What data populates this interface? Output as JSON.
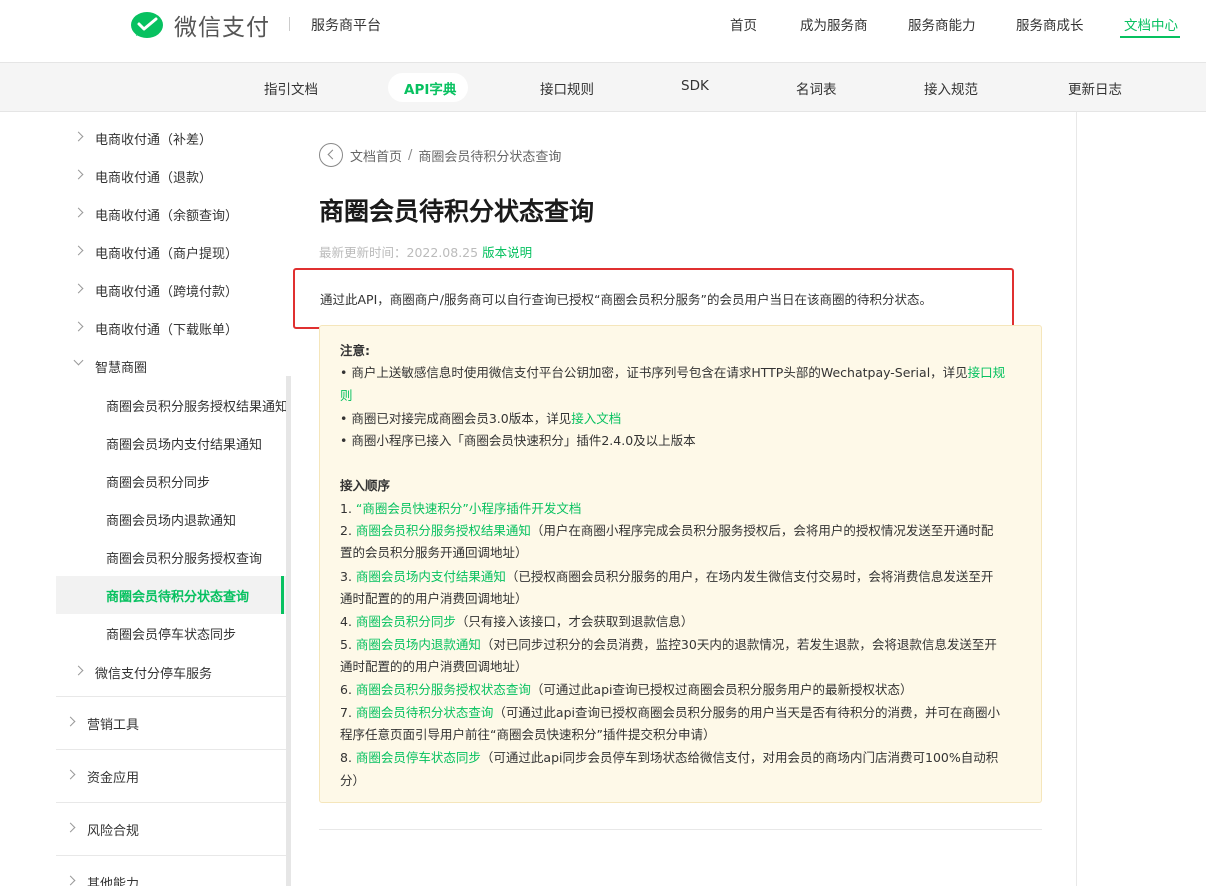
{
  "header": {
    "logo_text": "微信支付",
    "platform": "服务商平台",
    "nav": [
      "首页",
      "成为服务商",
      "服务商能力",
      "服务商成长",
      "文档中心"
    ],
    "nav_active": "文档中心"
  },
  "subnav": {
    "items": [
      "指引文档",
      "API字典",
      "接口规则",
      "SDK",
      "名词表",
      "接入规范",
      "更新日志"
    ],
    "active": "API字典"
  },
  "sidebar": {
    "items": [
      {
        "label": "电商收付通（补差）",
        "level": 1
      },
      {
        "label": "电商收付通（退款）",
        "level": 1
      },
      {
        "label": "电商收付通（余额查询）",
        "level": 1
      },
      {
        "label": "电商收付通（商户提现）",
        "level": 1
      },
      {
        "label": "电商收付通（跨境付款）",
        "level": 1
      },
      {
        "label": "电商收付通（下载账单）",
        "level": 1
      },
      {
        "label": "智慧商圈",
        "level": 1,
        "expanded": true
      },
      {
        "label": "商圈会员积分服务授权结果通知",
        "level": 2
      },
      {
        "label": "商圈会员场内支付结果通知",
        "level": 2
      },
      {
        "label": "商圈会员积分同步",
        "level": 2
      },
      {
        "label": "商圈会员场内退款通知",
        "level": 2
      },
      {
        "label": "商圈会员积分服务授权查询",
        "level": 2
      },
      {
        "label": "商圈会员待积分状态查询",
        "level": 2,
        "selected": true
      },
      {
        "label": "商圈会员停车状态同步",
        "level": 2
      },
      {
        "label": "微信支付分停车服务",
        "level": 1
      }
    ],
    "groups": [
      "营销工具",
      "资金应用",
      "风险合规",
      "其他能力"
    ]
  },
  "breadcrumb": {
    "home": "文档首页",
    "sep": "/",
    "current": "商圈会员待积分状态查询"
  },
  "page_title": "商圈会员待积分状态查询",
  "meta": {
    "updated_label": "最新更新时间：",
    "updated_date": "2022.08.25",
    "version_link": "版本说明"
  },
  "intro": "通过此API，商圈商户/服务商可以自行查询已授权“商圈会员积分服务”的会员用户当日在该商圈的待积分状态。",
  "notice": {
    "heading": "注意:",
    "line1_a": "• 商户上送敏感信息时使用微信支付平台公钥加密，证书序列号包含在请求HTTP头部的Wechatpay-Serial，详见",
    "line1_link_a": "接口规",
    "line1_link_b": "则",
    "line2_a": "• 商圈已对接完成商圈会员3.0版本，详见",
    "line2_link": "接入文档",
    "line3": "• 商圈小程序已接入「商圈会员快速积分」插件2.4.0及以上版本"
  },
  "order": {
    "heading": "接入顺序",
    "steps": [
      {
        "num": "1. ",
        "link": "“商圈会员快速积分”小程序插件开发文档",
        "desc": "",
        "desc2": ""
      },
      {
        "num": "2. ",
        "link": "商圈会员积分服务授权结果通知",
        "desc": "（用户在商圈小程序完成会员积分服务授权后，会将用户的授权情况发送至开通时配",
        "desc2": "置的会员积分服务开通回调地址）"
      },
      {
        "num": "3. ",
        "link": "商圈会员场内支付结果通知",
        "desc": "（已授权商圈会员积分服务的用户，在场内发生微信支付交易时，会将消费信息发送至开",
        "desc2": "通时配置的的用户消费回调地址）"
      },
      {
        "num": "4. ",
        "link": "商圈会员积分同步",
        "desc": "（只有接入该接口，才会获取到退款信息）",
        "desc2": ""
      },
      {
        "num": "5. ",
        "link": "商圈会员场内退款通知",
        "desc": "（对已同步过积分的会员消费，监控30天内的退款情况，若发生退款，会将退款信息发送至开",
        "desc2": "通时配置的的用户消费回调地址）"
      },
      {
        "num": "6. ",
        "link": "商圈会员积分服务授权状态查询",
        "desc": "（可通过此api查询已授权过商圈会员积分服务用户的最新授权状态）",
        "desc2": ""
      },
      {
        "num": "7. ",
        "link": "商圈会员待积分状态查询",
        "desc": "（可通过此api查询已授权商圈会员积分服务的用户当天是否有待积分的消费，并可在商圈小",
        "desc2": "程序任意页面引导用户前往“商圈会员快速积分”插件提交积分申请）"
      },
      {
        "num": "8. ",
        "link": "商圈会员停车状态同步",
        "desc": "（可通过此api同步会员停车到场状态给微信支付，对用会员的商场内门店消费可100%自动积",
        "desc2": "分）"
      }
    ]
  },
  "colors": {
    "brand_green": "#07c160",
    "highlight_red": "#e03030",
    "note_bg": "#fef9e8"
  }
}
